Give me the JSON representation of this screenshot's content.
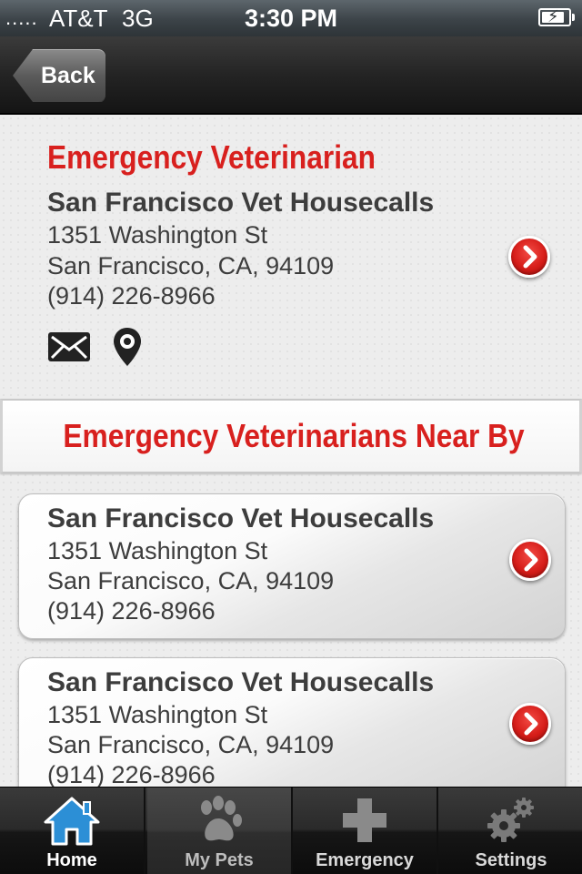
{
  "status_bar": {
    "signal": ".....",
    "carrier": "AT&T",
    "network": "3G",
    "time": "3:30 PM",
    "battery_level": 0.8
  },
  "nav": {
    "back_label": "Back"
  },
  "primary_vet": {
    "heading": "Emergency Veterinarian",
    "name": "San Francisco Vet Housecalls",
    "address": "1351 Washington St",
    "city": "San Francisco, CA, 94109",
    "phone": "(914) 226-8966"
  },
  "nearby": {
    "heading": "Emergency Veterinarians Near By",
    "items": [
      {
        "name": "San Francisco Vet Housecalls",
        "address": "1351 Washington St",
        "city": "San Francisco, CA, 94109",
        "phone": "(914) 226-8966"
      },
      {
        "name": "San Francisco Vet Housecalls",
        "address": "1351 Washington St",
        "city": "San Francisco, CA, 94109",
        "phone": "(914) 226-8966"
      }
    ]
  },
  "tab_bar": {
    "tabs": [
      {
        "label": "Home",
        "icon": "home-icon",
        "state": "active"
      },
      {
        "label": "My Pets",
        "icon": "paw-icon",
        "state": "selected"
      },
      {
        "label": "Emergency",
        "icon": "cross-icon",
        "state": "normal"
      },
      {
        "label": "Settings",
        "icon": "gear-icon",
        "state": "normal"
      }
    ]
  },
  "colors": {
    "accent_red": "#d8201e",
    "home_icon_blue": "#2c8fd6",
    "text_dark": "#3d3d3d"
  }
}
